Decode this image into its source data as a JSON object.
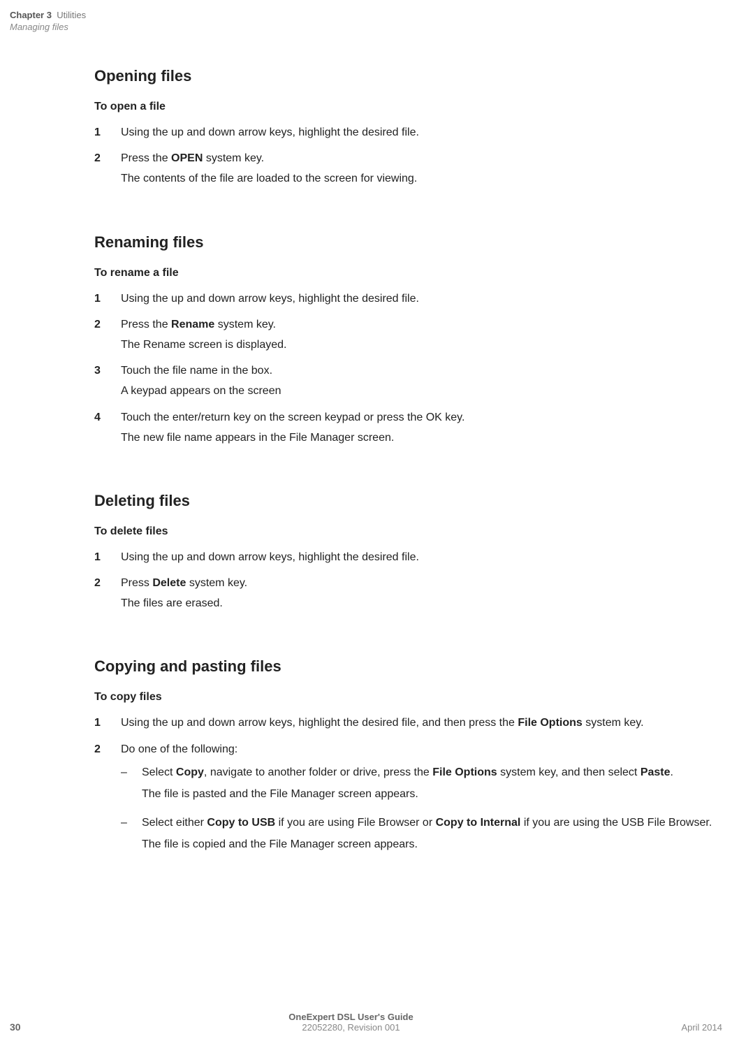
{
  "header": {
    "chapter_label": "Chapter 3",
    "chapter_title": "Utilities",
    "subtitle": "Managing files"
  },
  "sections": {
    "opening": {
      "heading": "Opening files",
      "sub": "To open a file",
      "s1": "Using the up and down arrow keys, highlight the desired file.",
      "s2a": "Press the ",
      "s2b": "OPEN",
      "s2c": " system key.",
      "s2r": "The contents of the file are loaded to the screen for viewing."
    },
    "renaming": {
      "heading": "Renaming files",
      "sub": "To rename a file",
      "s1": "Using the up and down arrow keys, highlight the desired file.",
      "s2a": "Press the ",
      "s2b": "Rename",
      "s2c": " system key.",
      "s2r": "The Rename screen is displayed.",
      "s3": "Touch the file name in the box.",
      "s3r": "A keypad appears on the screen",
      "s4": "Touch the enter/return key on the screen keypad or press the OK key.",
      "s4r": "The new file name appears in the File Manager screen."
    },
    "deleting": {
      "heading": "Deleting files",
      "sub": "To delete files",
      "s1": "Using the up and down arrow keys, highlight the desired file.",
      "s2a": "Press ",
      "s2b": "Delete",
      "s2c": " system key.",
      "s2r": "The files are erased."
    },
    "copying": {
      "heading": "Copying and pasting files",
      "sub": "To copy files",
      "s1a": "Using the up and down arrow keys, highlight the desired file, and then press the ",
      "s1b": "File Options",
      "s1c": " system key.",
      "s2": "Do one of the following:",
      "b1a": "Select ",
      "b1b": "Copy",
      "b1c": ", navigate to another folder or drive, press the ",
      "b1d": "File Options",
      "b1e": " system key, and then select ",
      "b1f": "Paste",
      "b1g": ".",
      "b1r": "The file is pasted and the File Manager screen appears.",
      "b2a": "Select either ",
      "b2b": "Copy to USB",
      "b2c": " if you are using File Browser or ",
      "b2d": "Copy to Internal",
      "b2e": " if you are using the USB File Browser.",
      "b2r": "The file is copied and the File Manager screen appears."
    }
  },
  "footer": {
    "page_num": "30",
    "guide_title": "OneExpert DSL User's Guide",
    "doc_id": "22052280, Revision 001",
    "date": "April 2014"
  },
  "dash": "–"
}
